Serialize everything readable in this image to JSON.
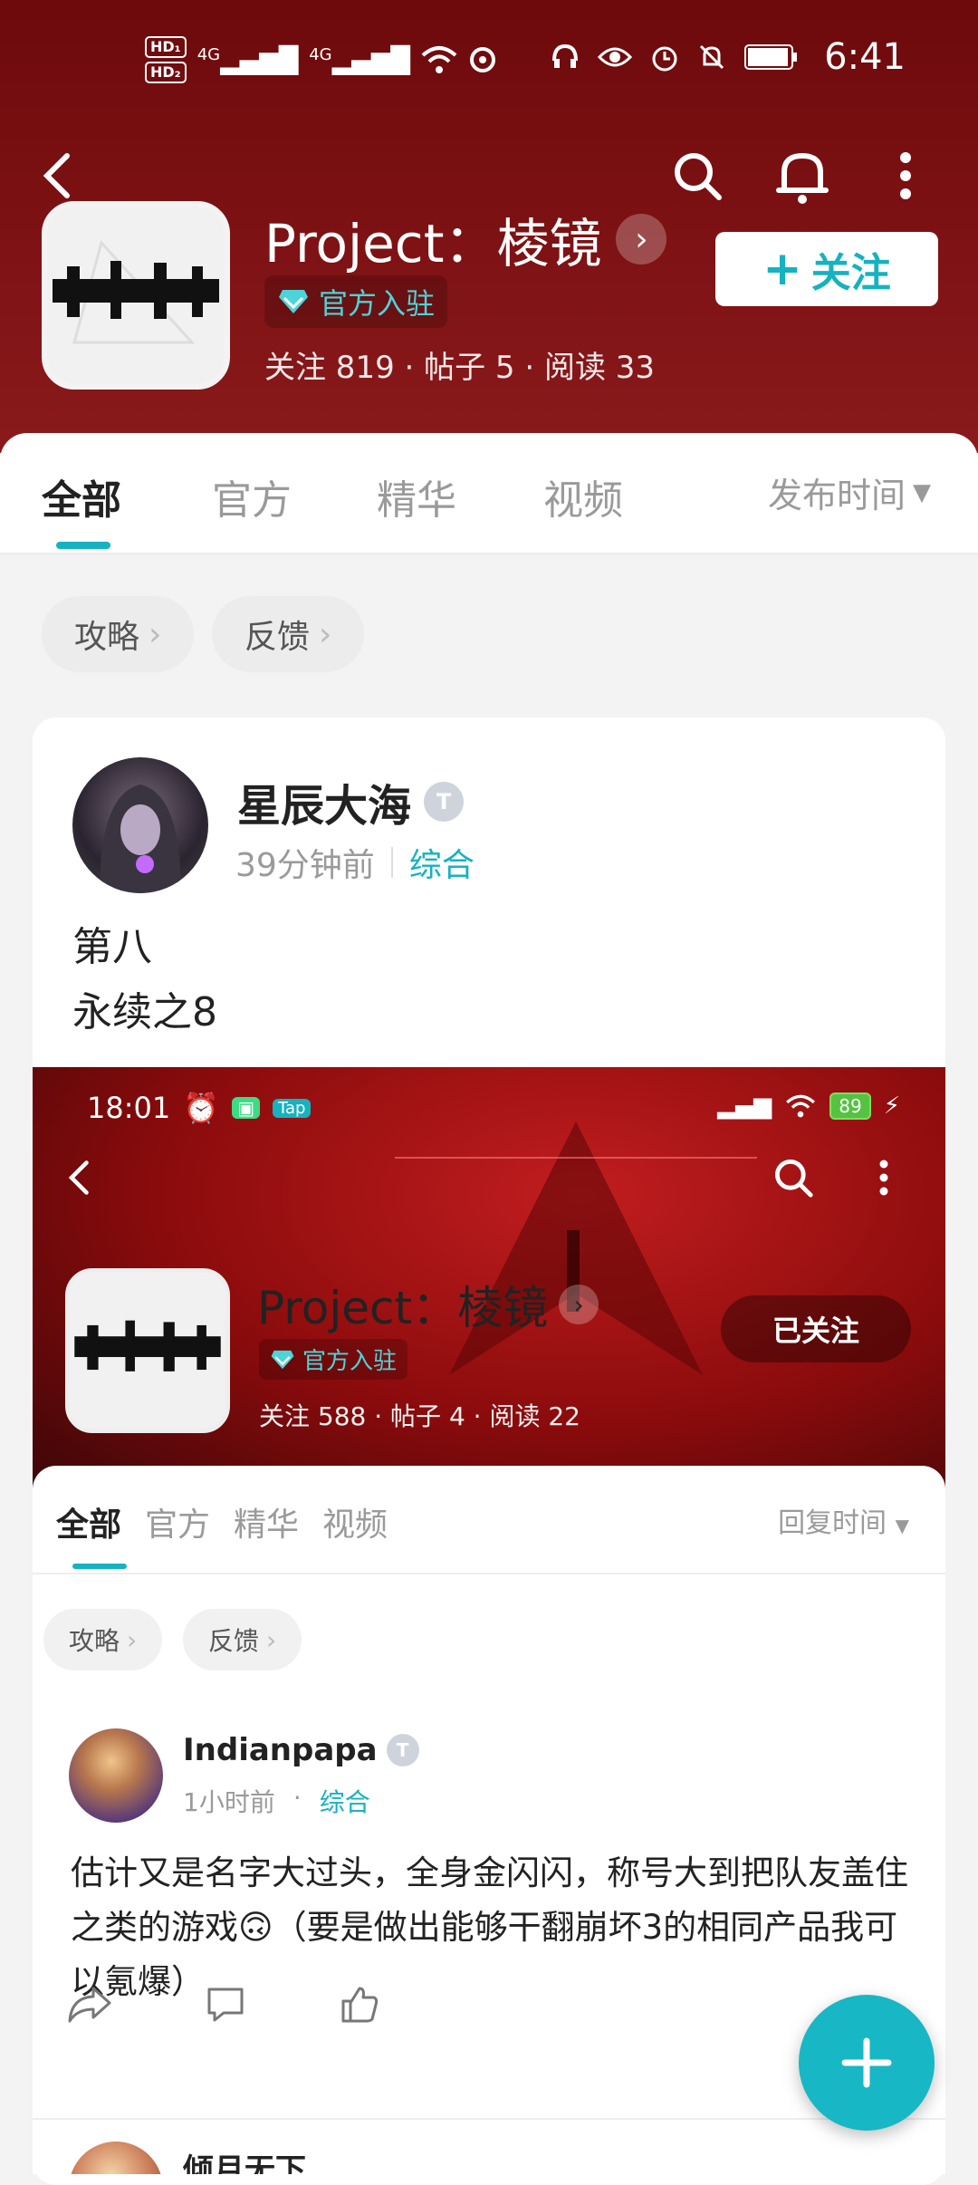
{
  "status_bar": {
    "time": "6:41",
    "network_1": "4G",
    "network_2": "4G"
  },
  "forum": {
    "title": "Project：棱镜",
    "verified_label": "官方入驻",
    "stats": "关注 819 · 帖子 5 · 阅读 33",
    "follow_label": "关注"
  },
  "tabs": [
    {
      "label": "全部"
    },
    {
      "label": "官方"
    },
    {
      "label": "精华"
    },
    {
      "label": "视频"
    }
  ],
  "sort_label": "发布时间",
  "chips": [
    {
      "label": "攻略"
    },
    {
      "label": "反馈"
    }
  ],
  "post": {
    "author": "星辰大海",
    "time": "39分钟前",
    "category": "综合",
    "text": "第八\n永续之8"
  },
  "screenshot": {
    "status_time": "18:01",
    "battery": "89",
    "title": "Project：棱镜",
    "verified_label": "官方入驻",
    "stats": "关注 588 · 帖子 4 · 阅读 22",
    "followed_label": "已关注",
    "tabs": [
      {
        "label": "全部"
      },
      {
        "label": "官方"
      },
      {
        "label": "精华"
      },
      {
        "label": "视频"
      }
    ],
    "sort_label": "回复时间",
    "chips": [
      {
        "label": "攻略"
      },
      {
        "label": "反馈"
      }
    ],
    "post": {
      "author": "Indianpapa",
      "time": "1小时前",
      "category": "综合",
      "text": "估计又是名字大过头，全身金闪闪，称号大到把队友盖住之类的游戏🙃（要是做出能够干翻崩坏3的相同产品我可以氪爆）"
    },
    "next_author": "倾月无下"
  },
  "colors": {
    "accent": "#16b2c0",
    "header": "#7e1214"
  },
  "icons": [
    "back-icon",
    "search-icon",
    "bell-icon",
    "more-icon",
    "share-icon",
    "comment-icon",
    "like-icon",
    "plus-icon"
  ]
}
